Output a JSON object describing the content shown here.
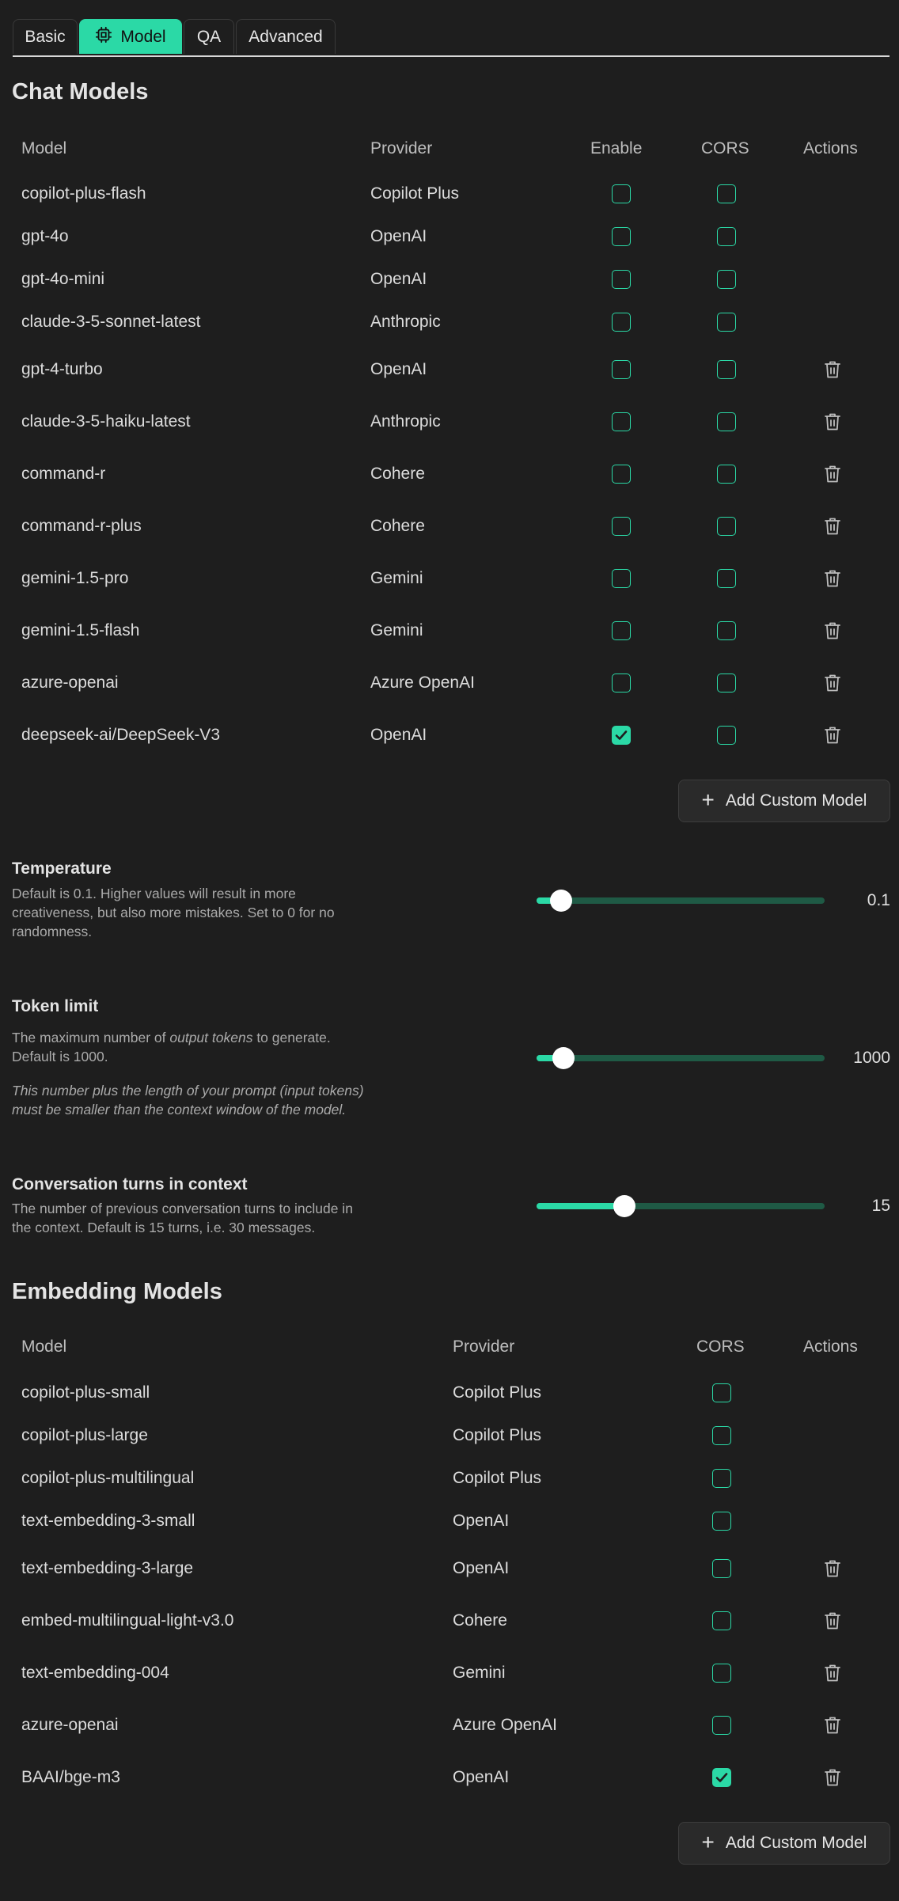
{
  "tabs": [
    {
      "label": "Basic",
      "active": false
    },
    {
      "label": "Model",
      "active": true
    },
    {
      "label": "QA",
      "active": false
    },
    {
      "label": "Advanced",
      "active": false
    }
  ],
  "chat_models": {
    "title": "Chat Models",
    "headers": {
      "model": "Model",
      "provider": "Provider",
      "enable": "Enable",
      "cors": "CORS",
      "actions": "Actions"
    },
    "rows": [
      {
        "model": "copilot-plus-flash",
        "provider": "Copilot Plus",
        "enable": false,
        "cors": false,
        "deletable": false
      },
      {
        "model": "gpt-4o",
        "provider": "OpenAI",
        "enable": false,
        "cors": false,
        "deletable": false
      },
      {
        "model": "gpt-4o-mini",
        "provider": "OpenAI",
        "enable": false,
        "cors": false,
        "deletable": false
      },
      {
        "model": "claude-3-5-sonnet-latest",
        "provider": "Anthropic",
        "enable": false,
        "cors": false,
        "deletable": false
      },
      {
        "model": "gpt-4-turbo",
        "provider": "OpenAI",
        "enable": false,
        "cors": false,
        "deletable": true
      },
      {
        "model": "claude-3-5-haiku-latest",
        "provider": "Anthropic",
        "enable": false,
        "cors": false,
        "deletable": true
      },
      {
        "model": "command-r",
        "provider": "Cohere",
        "enable": false,
        "cors": false,
        "deletable": true
      },
      {
        "model": "command-r-plus",
        "provider": "Cohere",
        "enable": false,
        "cors": false,
        "deletable": true
      },
      {
        "model": "gemini-1.5-pro",
        "provider": "Gemini",
        "enable": false,
        "cors": false,
        "deletable": true
      },
      {
        "model": "gemini-1.5-flash",
        "provider": "Gemini",
        "enable": false,
        "cors": false,
        "deletable": true
      },
      {
        "model": "azure-openai",
        "provider": "Azure OpenAI",
        "enable": false,
        "cors": false,
        "deletable": true
      },
      {
        "model": "deepseek-ai/DeepSeek-V3",
        "provider": "OpenAI",
        "enable": true,
        "cors": false,
        "deletable": true
      }
    ],
    "add_button": "Add Custom Model"
  },
  "settings": {
    "temperature": {
      "title": "Temperature",
      "desc": "Default is 0.1. Higher values will result in more creativeness, but also more mistakes. Set to 0 for no randomness.",
      "value": "0.1",
      "fraction": 0.05
    },
    "token_limit": {
      "title": "Token limit",
      "desc_before": "The maximum number of ",
      "desc_em": "output tokens",
      "desc_after": " to generate. Default is 1000.",
      "note": "This number plus the length of your prompt (input tokens) must be smaller than the context window of the model.",
      "value": "1000",
      "fraction": 0.06
    },
    "turns": {
      "title": "Conversation turns in context",
      "desc": "The number of previous conversation turns to include in the context. Default is 15 turns, i.e. 30 messages.",
      "value": "15",
      "fraction": 0.29
    }
  },
  "embedding_models": {
    "title": "Embedding Models",
    "headers": {
      "model": "Model",
      "provider": "Provider",
      "cors": "CORS",
      "actions": "Actions"
    },
    "rows": [
      {
        "model": "copilot-plus-small",
        "provider": "Copilot Plus",
        "cors": false,
        "deletable": false
      },
      {
        "model": "copilot-plus-large",
        "provider": "Copilot Plus",
        "cors": false,
        "deletable": false
      },
      {
        "model": "copilot-plus-multilingual",
        "provider": "Copilot Plus",
        "cors": false,
        "deletable": false
      },
      {
        "model": "text-embedding-3-small",
        "provider": "OpenAI",
        "cors": false,
        "deletable": false
      },
      {
        "model": "text-embedding-3-large",
        "provider": "OpenAI",
        "cors": false,
        "deletable": true
      },
      {
        "model": "embed-multilingual-light-v3.0",
        "provider": "Cohere",
        "cors": false,
        "deletable": true
      },
      {
        "model": "text-embedding-004",
        "provider": "Gemini",
        "cors": false,
        "deletable": true
      },
      {
        "model": "azure-openai",
        "provider": "Azure OpenAI",
        "cors": false,
        "deletable": true
      },
      {
        "model": "BAAI/bge-m3",
        "provider": "OpenAI",
        "cors": true,
        "deletable": true
      }
    ],
    "add_button": "Add Custom Model"
  },
  "icons": {
    "model_tab": "cpu-icon",
    "delete": "trash-icon",
    "add": "plus-icon",
    "check": "check-icon"
  },
  "colors": {
    "accent": "#2bd9a6",
    "background": "#1e1e1e",
    "track": "#1f5a45"
  }
}
